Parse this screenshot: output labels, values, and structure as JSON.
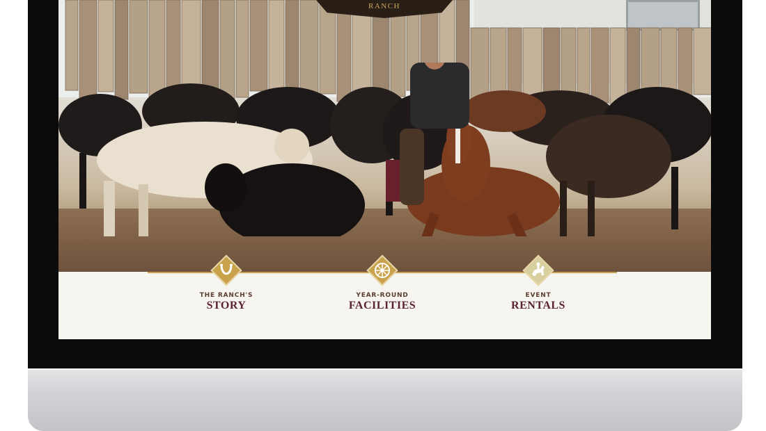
{
  "brand": {
    "logo_text": "RANCH"
  },
  "nav": {
    "items": [
      {
        "kicker": "THE RANCH'S",
        "title": "STORY",
        "icon": "horseshoe-icon"
      },
      {
        "kicker": "YEAR-ROUND",
        "title": "FACILITIES",
        "icon": "wagon-wheel-icon"
      },
      {
        "kicker": "EVENT",
        "title": "RENTALS",
        "icon": "horse-rider-icon"
      }
    ]
  },
  "colors": {
    "accent_gold": "#c9a24c",
    "title_maroon": "#5a2232",
    "kicker_brown": "#5b3d2e",
    "nav_background": "#f7f5f0",
    "bezel": "#0b0b0c",
    "logo_background": "#2a1f17"
  }
}
